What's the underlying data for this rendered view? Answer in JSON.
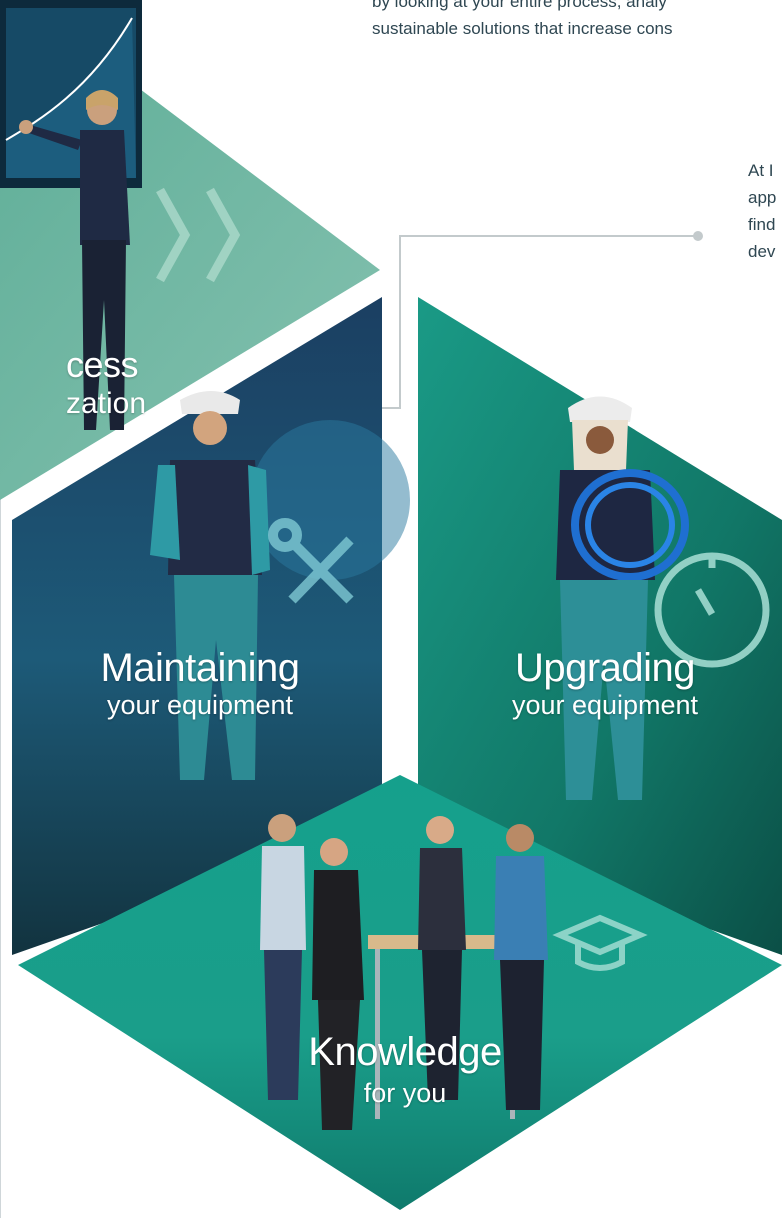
{
  "intro": {
    "line1": "by looking at your entire process, analy",
    "line2": "sustainable solutions that increase cons"
  },
  "side": {
    "line1": "At I",
    "line2": "app",
    "line3": "find",
    "line4": "dev"
  },
  "tiles": {
    "process": {
      "title": "cess",
      "subtitle": "zation"
    },
    "maintaining": {
      "title": "Maintaining",
      "subtitle": "your equipment"
    },
    "upgrading": {
      "title": "Upgrading",
      "subtitle": "your equipment"
    },
    "knowledge": {
      "title": "Knowledge",
      "subtitle": "for you"
    }
  },
  "colors": {
    "process_tile": "#6fb39f",
    "maintaining_tile": "#1d3f63",
    "upgrading_tile": "#14806f",
    "knowledge_tile": "#1aa08c",
    "accent": "#00a3a0",
    "text": "#2f4752",
    "connector": "#c3cacc"
  },
  "icons": {
    "process": "double-chevron-icon",
    "maintaining": "wrench-screwdriver-icon",
    "upgrading": "speedometer-icon",
    "knowledge": "graduation-cap-icon"
  }
}
